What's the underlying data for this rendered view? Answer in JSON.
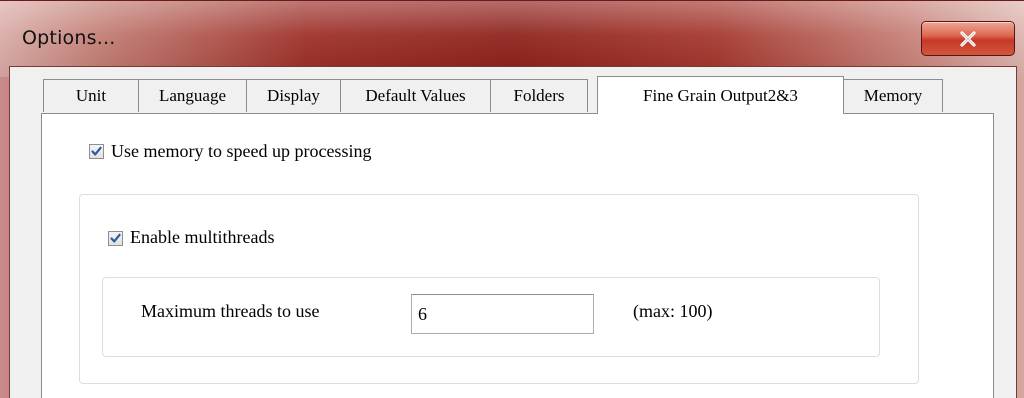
{
  "window": {
    "title": "Options..."
  },
  "tabs": [
    {
      "label": "Unit"
    },
    {
      "label": "Language"
    },
    {
      "label": "Display"
    },
    {
      "label": "Default Values"
    },
    {
      "label": "Folders"
    },
    {
      "label": "Fine Grain Output2&3"
    },
    {
      "label": "Memory"
    }
  ],
  "active_tab": "Fine Grain Output2&3",
  "memory": {
    "use_memory_label": "Use memory to speed up processing",
    "use_memory_checked": true,
    "multithreads_label": "Enable multithreads",
    "multithreads_checked": true,
    "max_threads_label": "Maximum threads to use",
    "max_threads_value": "6",
    "max_hint": "(max: 100)"
  },
  "colors": {
    "titlebar": "#8e1f1b",
    "check_mark": "#2c5aa0",
    "close_button": "#c43a26"
  }
}
